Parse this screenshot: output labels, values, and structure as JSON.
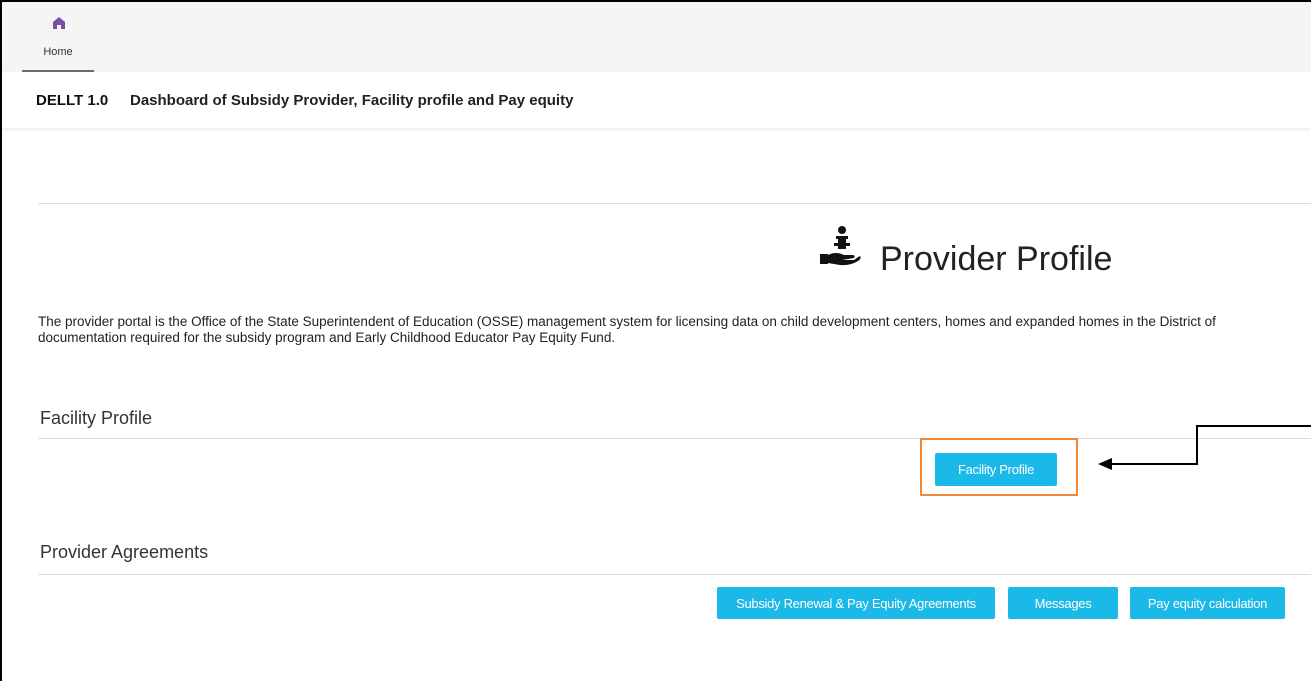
{
  "tabs": {
    "home": {
      "label": "Home",
      "icon": "home-icon",
      "icon_color": "#7b4fa6"
    }
  },
  "header": {
    "app_name": "DELLT 1.0",
    "subtitle": "Dashboard of Subsidy Provider, Facility profile and Pay equity"
  },
  "main": {
    "title": "Provider Profile",
    "title_icon": "provider-care-icon",
    "description_line1": "The provider portal is the Office of the State Superintendent of Education (OSSE) management system for licensing data on child development centers, homes and expanded homes in the District of",
    "description_line2": "documentation required for the subsidy program and Early Childhood Educator Pay Equity Fund."
  },
  "facility_section": {
    "title": "Facility Profile",
    "button_label": "Facility Profile"
  },
  "agreements_section": {
    "title": "Provider Agreements",
    "buttons": [
      {
        "label": "Subsidy Renewal & Pay Equity Agreements"
      },
      {
        "label": "Messages"
      },
      {
        "label": "Pay equity calculation"
      }
    ]
  },
  "colors": {
    "button_bg": "#1ab9e8",
    "highlight": "#f0883a",
    "home_icon": "#7b4fa6"
  }
}
